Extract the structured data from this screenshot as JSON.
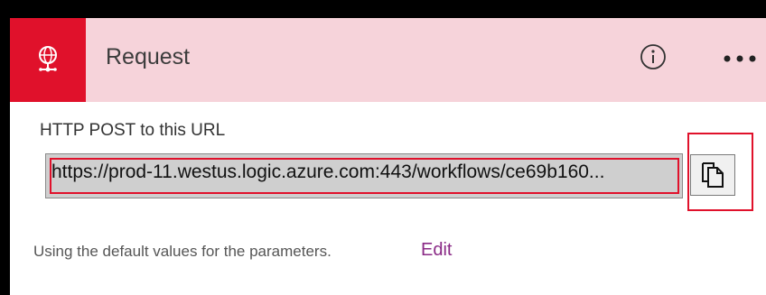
{
  "header": {
    "title": "Request",
    "trigger_icon": "globe-network-icon",
    "info_icon": "info-icon",
    "more_icon": "more-icon",
    "accent_color": "#e0112b",
    "header_bg": "#f6d3da"
  },
  "body": {
    "url_label": "HTTP POST to this URL",
    "url_value": "https://prod-11.westus.logic.azure.com:443/workflows/ce69b160...",
    "copy_icon": "copy-icon",
    "footer_text": "Using the default values for the parameters.",
    "edit_label": "Edit",
    "edit_color": "#8a2a86"
  }
}
